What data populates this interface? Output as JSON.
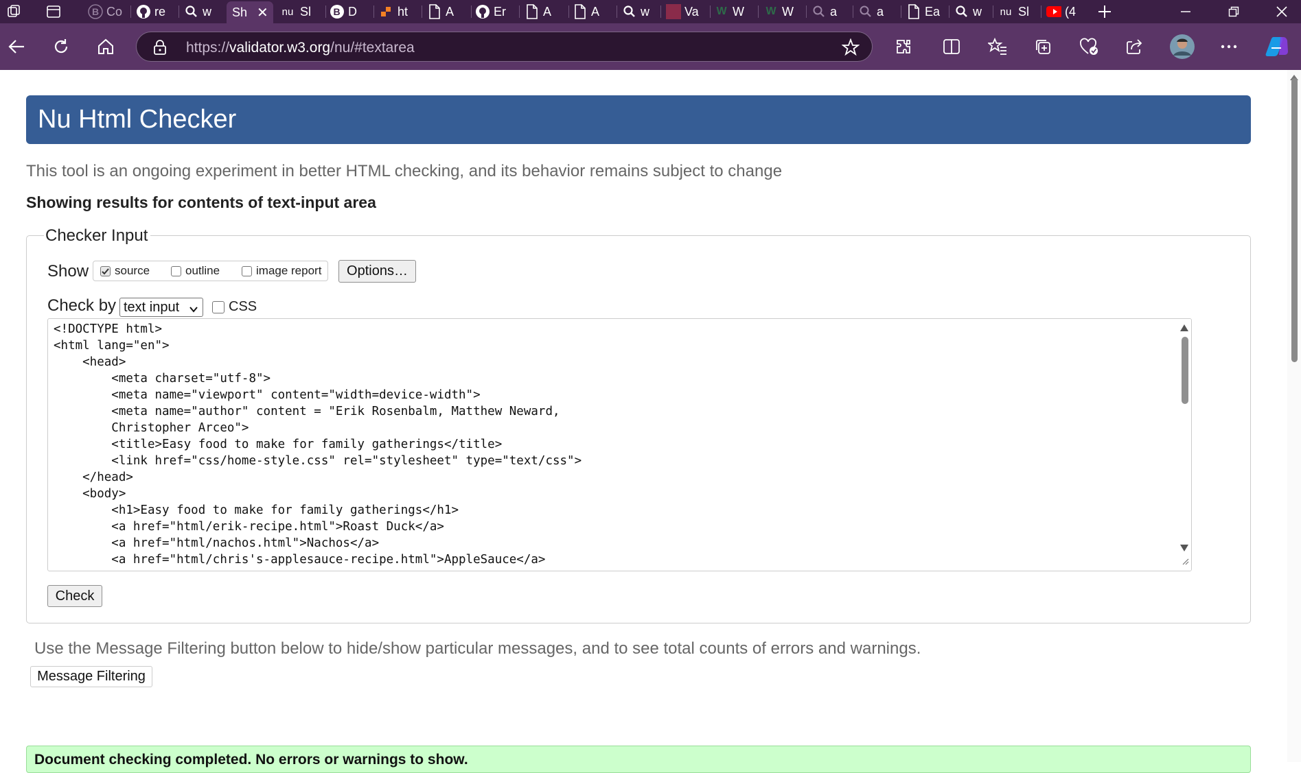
{
  "browser": {
    "tabs": [
      {
        "label": "re",
        "icon": "github-icon"
      },
      {
        "label": "w",
        "icon": "search-icon"
      },
      {
        "label": "Sh",
        "icon": "none",
        "active": true
      },
      {
        "label": "Sl",
        "icon": "nu-icon"
      },
      {
        "label": "D",
        "icon": "bootstrap-icon"
      },
      {
        "label": "ht",
        "icon": "stackoverflow-icon"
      },
      {
        "label": "A",
        "icon": "document-icon"
      },
      {
        "label": "Er",
        "icon": "github-icon"
      },
      {
        "label": "A",
        "icon": "document-icon"
      },
      {
        "label": "A",
        "icon": "document-icon"
      },
      {
        "label": "w",
        "icon": "search-icon"
      },
      {
        "label": "Va",
        "icon": "square-icon"
      },
      {
        "label": "W",
        "icon": "w-icon"
      },
      {
        "label": "W",
        "icon": "w-icon"
      },
      {
        "label": "a",
        "icon": "search-icon"
      },
      {
        "label": "a",
        "icon": "search-icon"
      },
      {
        "label": "Ea",
        "icon": "document-icon"
      },
      {
        "label": "w",
        "icon": "search-icon"
      },
      {
        "label": "Sl",
        "icon": "nu-icon"
      },
      {
        "label": "(4",
        "icon": "youtube-icon"
      }
    ],
    "first_tab_label": "Co",
    "nu_favicon_text": "nu",
    "address": {
      "scheme": "https://",
      "host": "validator.w3.org",
      "path": "/nu/#textarea"
    },
    "colors": {
      "tabstrip": "#3b1f45",
      "toolbar": "#5a3566"
    }
  },
  "page": {
    "title": "Nu Html Checker",
    "tagline": "This tool is an ongoing experiment in better HTML checking, and its behavior remains subject to change",
    "results_heading": "Showing results for contents of text-input area",
    "checker_input": {
      "legend": "Checker Input",
      "show_label": "Show",
      "show_options": [
        {
          "label": "source",
          "checked": true
        },
        {
          "label": "outline",
          "checked": false
        },
        {
          "label": "image report",
          "checked": false
        }
      ],
      "options_button": "Options…",
      "check_by_label": "Check by",
      "check_by_value": "text input",
      "css_label": "CSS",
      "css_checked": false,
      "source_text": "<!DOCTYPE html>\n<html lang=\"en\">\n    <head>\n        <meta charset=\"utf-8\">\n        <meta name=\"viewport\" content=\"width=device-width\">\n        <meta name=\"author\" content = \"Erik Rosenbalm, Matthew Neward,\n        Christopher Arceo\">\n        <title>Easy food to make for family gatherings</title>\n        <link href=\"css/home-style.css\" rel=\"stylesheet\" type=\"text/css\">\n    </head>\n    <body>\n        <h1>Easy food to make for family gatherings</h1>\n        <a href=\"html/erik-recipe.html\">Roast Duck</a>\n        <a href=\"html/nachos.html\">Nachos</a>\n        <a href=\"html/chris's-applesauce-recipe.html\">AppleSauce</a>",
      "check_button": "Check"
    },
    "filter_text": "Use the Message Filtering button below to hide/show particular messages, and to see total counts of errors and warnings.",
    "filter_button": "Message Filtering",
    "status_text": "Document checking completed. No errors or warnings to show.",
    "colors": {
      "header": "#365d95",
      "status_bg": "#ccffcc"
    }
  }
}
